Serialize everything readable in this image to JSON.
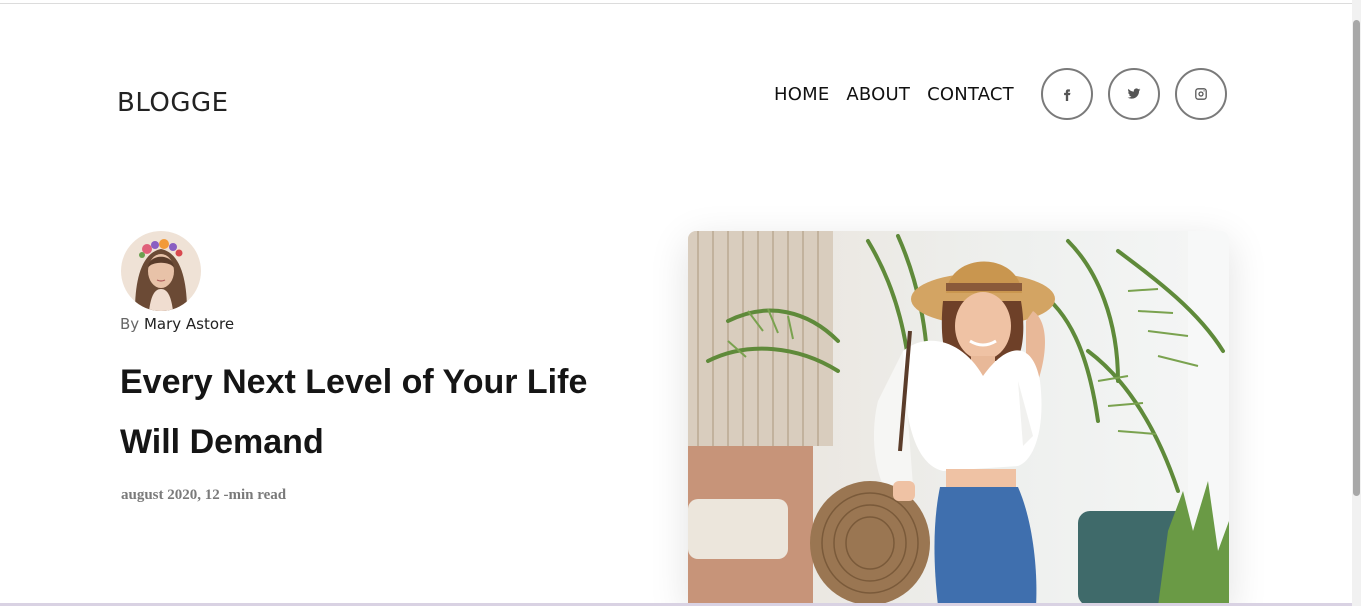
{
  "brand": {
    "logo_text": "BLOGGE"
  },
  "nav": {
    "items": [
      {
        "label": "HOME"
      },
      {
        "label": "ABOUT"
      },
      {
        "label": "CONTACT"
      }
    ]
  },
  "social": [
    {
      "icon": "facebook-icon"
    },
    {
      "icon": "twitter-icon"
    },
    {
      "icon": "instagram-icon"
    }
  ],
  "post": {
    "by_label": "By",
    "author": "Mary Astore",
    "title_line1": "Every Next Level of Your Life",
    "title_line2": "Will Demand",
    "meta": "august 2020, 12 -min read"
  },
  "colors": {
    "text": "#111111",
    "muted": "#7a7a7a",
    "hat": "#d3a463",
    "palm": "#5f8a3a"
  }
}
